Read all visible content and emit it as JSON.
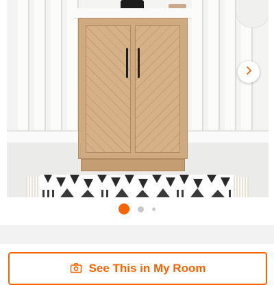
{
  "gallery": {
    "current_image": 1,
    "image_count": 3,
    "next_icon": "chevron-right-icon"
  },
  "ar_button": {
    "label": "See This in My Room",
    "icon": "camera-icon"
  },
  "colors": {
    "accent": "#f96302",
    "inactive_dot": "#c8c8c8",
    "divider": "#f2f2f2"
  }
}
